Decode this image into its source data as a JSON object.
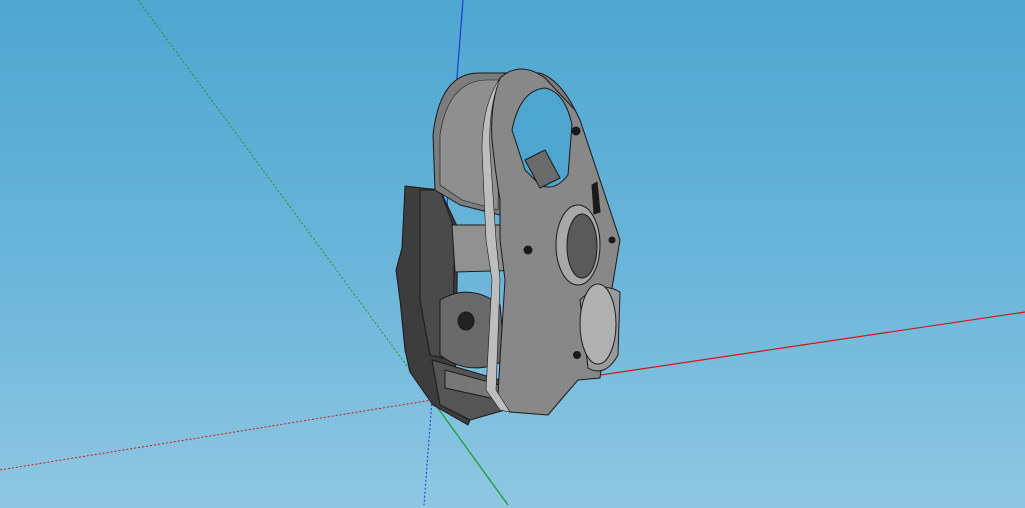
{
  "viewport": {
    "sky_top": "#4ea6d0",
    "sky_bottom": "#8fc7e2"
  },
  "axes": {
    "red_axis_color": "#d01818",
    "green_axis_color": "#1c9a28",
    "blue_axis_color": "#1a3cd8"
  },
  "model": {
    "fill_light": "#8a8a8a",
    "fill_mid": "#6e6e6e",
    "fill_dark": "#3a3a3a",
    "edge": "#1a1a1a"
  }
}
